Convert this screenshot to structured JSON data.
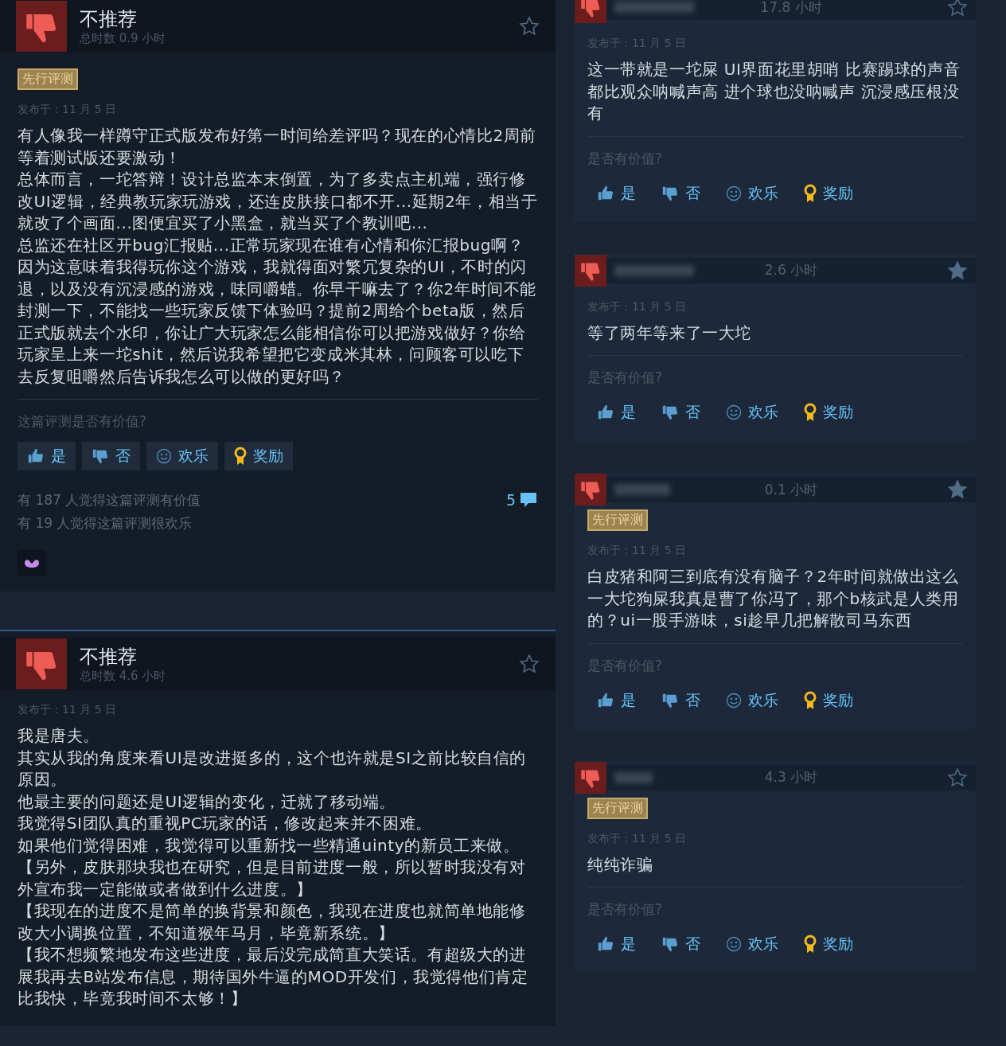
{
  "left_reviews": [
    {
      "verdict": "不推荐",
      "playtime": "总时数 0.9 小时",
      "starred": false,
      "early_access": "先行评测",
      "posted": "发布于：11 月 5 日",
      "body": [
        "有人像我一样蹲守正式版发布好第一时间给差评吗？现在的心情比2周前等着测试版还要激动！",
        "总体而言，一坨答辩！设计总监本末倒置，为了多卖点主机端，强行修改UI逻辑，经典教玩家玩游戏，还连皮肤接口都不开...延期2年，相当于就改了个画面...图便宜买了小黑盒，就当买了个教训吧...",
        "总监还在社区开bug汇报贴...正常玩家现在谁有心情和你汇报bug啊？因为这意味着我得玩你这个游戏，我就得面对繁冗复杂的UI，不时的闪退，以及没有沉浸感的游戏，味同嚼蜡。你早干嘛去了？你2年时间不能封测一下，不能找一些玩家反馈下体验吗？提前2周给个beta版，然后正式版就去个水印，你让广大玩家怎么能相信你可以把游戏做好？你给玩家呈上来一坨shit，然后说我希望把它变成米其林，问顾客可以吃下去反复咀嚼然后告诉我怎么可以做的更好吗？"
      ],
      "helpful_prompt": "这篇评测是否有价值?",
      "buttons": [
        {
          "kind": "yes",
          "label": "是"
        },
        {
          "kind": "no",
          "label": "否"
        },
        {
          "kind": "funny",
          "label": "欢乐"
        },
        {
          "kind": "award",
          "label": "奖励"
        }
      ],
      "stats": [
        "有 187 人觉得这篇评测有价值",
        "有 19 人觉得这篇评测很欢乐"
      ],
      "comments": "5",
      "has_award": true
    },
    {
      "verdict": "不推荐",
      "playtime": "总时数 4.6 小时",
      "starred": false,
      "posted": "发布于：11 月 5 日",
      "body": [
        "我是唐夫。",
        "其实从我的角度来看UI是改进挺多的，这个也许就是SI之前比较自信的原因。",
        "他最主要的问题还是UI逻辑的变化，迁就了移动端。",
        "我觉得SI团队真的重视PC玩家的话，修改起来并不困难。",
        "如果他们觉得困难，我觉得可以重新找一些精通uinty的新员工来做。",
        "【另外，皮肤那块我也在研究，但是目前进度一般，所以暂时我没有对外宣布我一定能做或者做到什么进度。】",
        "【我现在的进度不是简单的换背景和颜色，我现在进度也就简单地能修改大小调换位置，不知道猴年马月，毕竟新系统。】",
        "【我不想频繁地发布这些进度，最后没完成简直大笑话。有超级大的进展我再去B站发布信息，期待国外牛逼的MOD开发们，我觉得他们肯定比我快，毕竟我时间不太够！】"
      ]
    }
  ],
  "right_reviews": [
    {
      "hours": "17.8 小时",
      "starred": false,
      "posted": "发布于：11 月 5 日",
      "body": "这一带就是一坨屎 UI界面花里胡哨 比赛踢球的声音都比观众呐喊声高 进个球也没呐喊声 沉浸感压根没有",
      "helpful_prompt": "是否有价值?",
      "buttons": [
        {
          "kind": "yes",
          "label": "是"
        },
        {
          "kind": "no",
          "label": "否"
        },
        {
          "kind": "funny",
          "label": "欢乐"
        },
        {
          "kind": "award",
          "label": "奖励"
        }
      ]
    },
    {
      "hours": "2.6 小时",
      "starred": true,
      "posted": "发布于：11 月 5 日",
      "body": "等了两年等来了一大坨",
      "helpful_prompt": "是否有价值?",
      "buttons": [
        {
          "kind": "yes",
          "label": "是"
        },
        {
          "kind": "no",
          "label": "否"
        },
        {
          "kind": "funny",
          "label": "欢乐"
        },
        {
          "kind": "award",
          "label": "奖励"
        }
      ]
    },
    {
      "hours": "0.1 小时",
      "starred": true,
      "early_access": "先行评测",
      "posted": "发布于：11 月 5 日",
      "body": "白皮猪和阿三到底有没有脑子？2年时间就做出这么一大坨狗屎我真是曹了你冯了，那个b核武是人类用的？ui一股手游味，si趁早几把解散司马东西",
      "helpful_prompt": "是否有价值?",
      "buttons": [
        {
          "kind": "yes",
          "label": "是"
        },
        {
          "kind": "no",
          "label": "否"
        },
        {
          "kind": "funny",
          "label": "欢乐"
        },
        {
          "kind": "award",
          "label": "奖励"
        }
      ]
    },
    {
      "hours": "4.3 小时",
      "starred": false,
      "early_access": "先行评测",
      "posted": "发布于：11 月 5 日",
      "body": "纯纯诈骗",
      "helpful_prompt": "是否有价值?",
      "buttons": [
        {
          "kind": "yes",
          "label": "是"
        },
        {
          "kind": "no",
          "label": "否"
        },
        {
          "kind": "funny",
          "label": "欢乐"
        },
        {
          "kind": "award",
          "label": "奖励"
        }
      ]
    }
  ]
}
